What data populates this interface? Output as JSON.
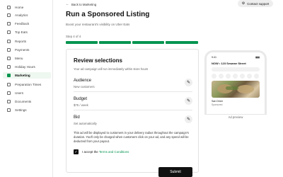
{
  "sidebar": {
    "items": [
      {
        "label": "Home",
        "icon": "home-icon"
      },
      {
        "label": "Analytics",
        "icon": "chart-icon"
      },
      {
        "label": "Feedback",
        "icon": "feedback-icon"
      },
      {
        "label": "Top Eats",
        "icon": "star-icon"
      },
      {
        "label": "Reports",
        "icon": "report-icon"
      },
      {
        "label": "Payments",
        "icon": "payment-icon"
      },
      {
        "label": "Menu",
        "icon": "menu-icon"
      },
      {
        "label": "Holiday Hours",
        "icon": "calendar-icon"
      },
      {
        "label": "Marketing",
        "icon": "megaphone-icon",
        "active": true
      },
      {
        "label": "Preparation Times",
        "icon": "clock-icon"
      },
      {
        "label": "Users",
        "icon": "users-icon"
      },
      {
        "label": "Documents",
        "icon": "document-icon"
      },
      {
        "label": "Settings",
        "icon": "gear-icon"
      }
    ]
  },
  "header": {
    "back_label": "Back to Marketing",
    "contact_label": "Contact support",
    "title": "Run a Sponsored Listing",
    "subtitle": "Boost your restaurant's visibility on Uber Eats"
  },
  "progress": {
    "step_label": "Step 4 of 4",
    "total_steps": 4,
    "completed_steps": 4,
    "color": "#05944f"
  },
  "review": {
    "title": "Review selections",
    "note": "Your ad campaign will run immediately within store hours",
    "rows": [
      {
        "label": "Audience",
        "value": "New customers"
      },
      {
        "label": "Budget",
        "value": "$75 / week"
      },
      {
        "label": "Bid",
        "value": "Set automatically"
      }
    ],
    "disclaimer": "This ad will be displayed to customers in your delivery radius throughout the campaign's duration. You'll only be charged when customers click on your ad, and any spend will be deducted from your payout.",
    "accept_prefix": "I accept the ",
    "accept_link": "Terms and Conditions",
    "accept_checked": true,
    "submit_label": "Submit"
  },
  "preview": {
    "time": "9:41",
    "signal": "▮▮▮",
    "address": "NOW • 123 Sesame Street",
    "store_name": "San Diner",
    "store_sub": "Sponsored",
    "caption": "Ad preview"
  }
}
